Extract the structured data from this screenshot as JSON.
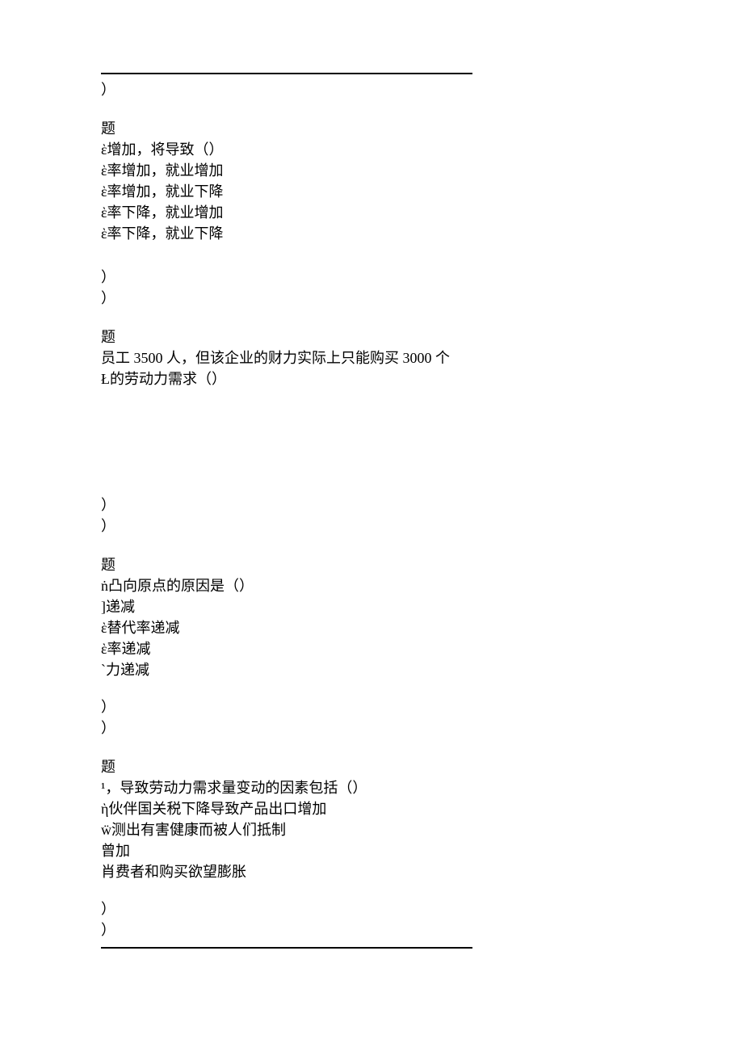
{
  "top": {
    "paren": "）"
  },
  "q1": {
    "header": "题",
    "stem": "ὲ增加，将导致（）",
    "optA": "ὲ率增加，就业增加",
    "optB": "ὲ率增加，就业下降",
    "optC": "ὲ率下降，就业增加",
    "optD": "ὲ率下降，就业下降",
    "paren1": "）",
    "paren2": "）"
  },
  "q2": {
    "header": "题",
    "stem1": "员工 3500 人，但该企业的财力实际上只能购买 3000 个",
    "stem2": "Ł的劳动力需求（）",
    "paren1": "）",
    "paren2": "）"
  },
  "q3": {
    "header": "题",
    "stem": "ṅ凸向原点的原因是（）",
    "optA": "]递减",
    "optB": "ὲ替代率递减",
    "optC": "ὲ率递减",
    "optD": "`力递减",
    "paren1": "）",
    "paren2": "）"
  },
  "q4": {
    "header": "题",
    "stem": "¹，导致劳动力需求量变动的因素包括（）",
    "optA": "ὴ伙伴国关税下降导致产品出口增加",
    "optB": "ẅ测出有害健康而被人们抵制",
    "optC": "曾加",
    "optD": "肖费者和购买欲望膨胀",
    "paren1": "）",
    "paren2": "）"
  }
}
